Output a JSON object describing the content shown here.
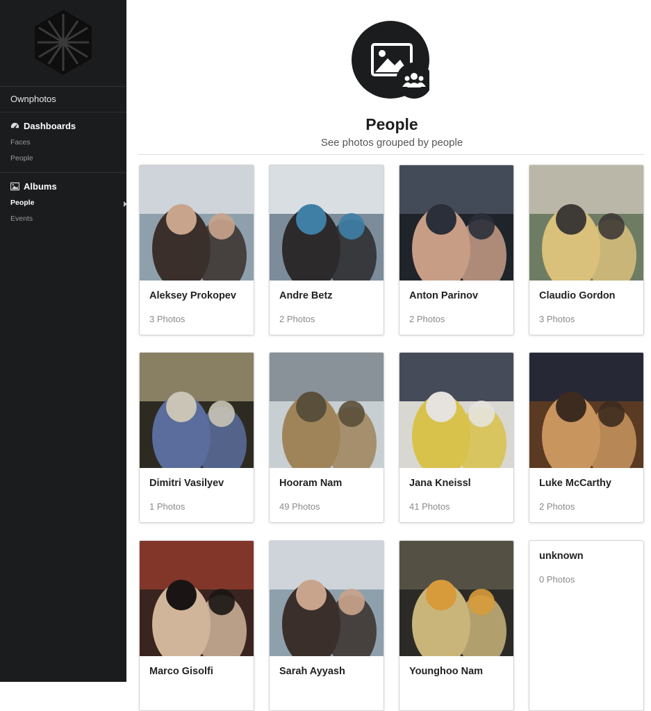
{
  "sidebar": {
    "app_name": "Ownphotos",
    "dashboards_label": "Dashboards",
    "dashboards_items": [
      "Faces",
      "People"
    ],
    "albums_label": "Albums",
    "albums_items": [
      "People",
      "Events"
    ],
    "active_item": "People"
  },
  "header": {
    "title": "People",
    "subtitle": "See photos grouped by people",
    "icon": "photo-group-icon"
  },
  "people": [
    {
      "name": "Aleksey Prokopev",
      "count": "3 Photos",
      "palette": [
        "#8fa0ad",
        "#d9dde0",
        "#3a2f2b",
        "#c9a48c"
      ]
    },
    {
      "name": "Andre Betz",
      "count": "2 Photos",
      "palette": [
        "#7c8c9a",
        "#e9ecef",
        "#2d2a2c",
        "#3f7fa6"
      ]
    },
    {
      "name": "Anton Parinov",
      "count": "2 Photos",
      "palette": [
        "#1f232a",
        "#4b5260",
        "#c79d86",
        "#2a2f3a"
      ]
    },
    {
      "name": "Claudio Gordon",
      "count": "3 Photos",
      "palette": [
        "#6f7c64",
        "#c8c2b4",
        "#d9c07b",
        "#3e3a36"
      ]
    },
    {
      "name": "Dimitri Vasilyev",
      "count": "1 Photos",
      "palette": [
        "#2d2a22",
        "#9a8f6e",
        "#5b6d9c",
        "#c9c4b5"
      ]
    },
    {
      "name": "Hooram Nam",
      "count": "49 Photos",
      "palette": [
        "#c8cfd3",
        "#7e878d",
        "#a08459",
        "#5a4f3a"
      ]
    },
    {
      "name": "Jana Kneissl",
      "count": "41 Photos",
      "palette": [
        "#d9d7d2",
        "#2c3345",
        "#d8c24c",
        "#e6e3de"
      ]
    },
    {
      "name": "Luke McCarthy",
      "count": "2 Photos",
      "palette": [
        "#5a3a22",
        "#1d2738",
        "#c8955e",
        "#3d2b1f"
      ]
    },
    {
      "name": "Marco Gisolfi",
      "count": "",
      "palette": [
        "#3a2420",
        "#8e3a2c",
        "#d0b59a",
        "#1a1514"
      ]
    },
    {
      "name": "Sarah Ayyash",
      "count": "",
      "palette": [
        "#8fa0ad",
        "#d9dde0",
        "#3a2f2b",
        "#c9a48c"
      ]
    },
    {
      "name": "Younghoo Nam",
      "count": "",
      "palette": [
        "#2b2a26",
        "#5d574a",
        "#c9b47a",
        "#d89b3b"
      ]
    },
    {
      "name": "unknown",
      "count": "0 Photos",
      "palette": []
    }
  ],
  "colors": {
    "sidebar_bg": "#1b1c1d",
    "card_border": "#d4d4d5",
    "count_text": "#8a8a8a"
  }
}
